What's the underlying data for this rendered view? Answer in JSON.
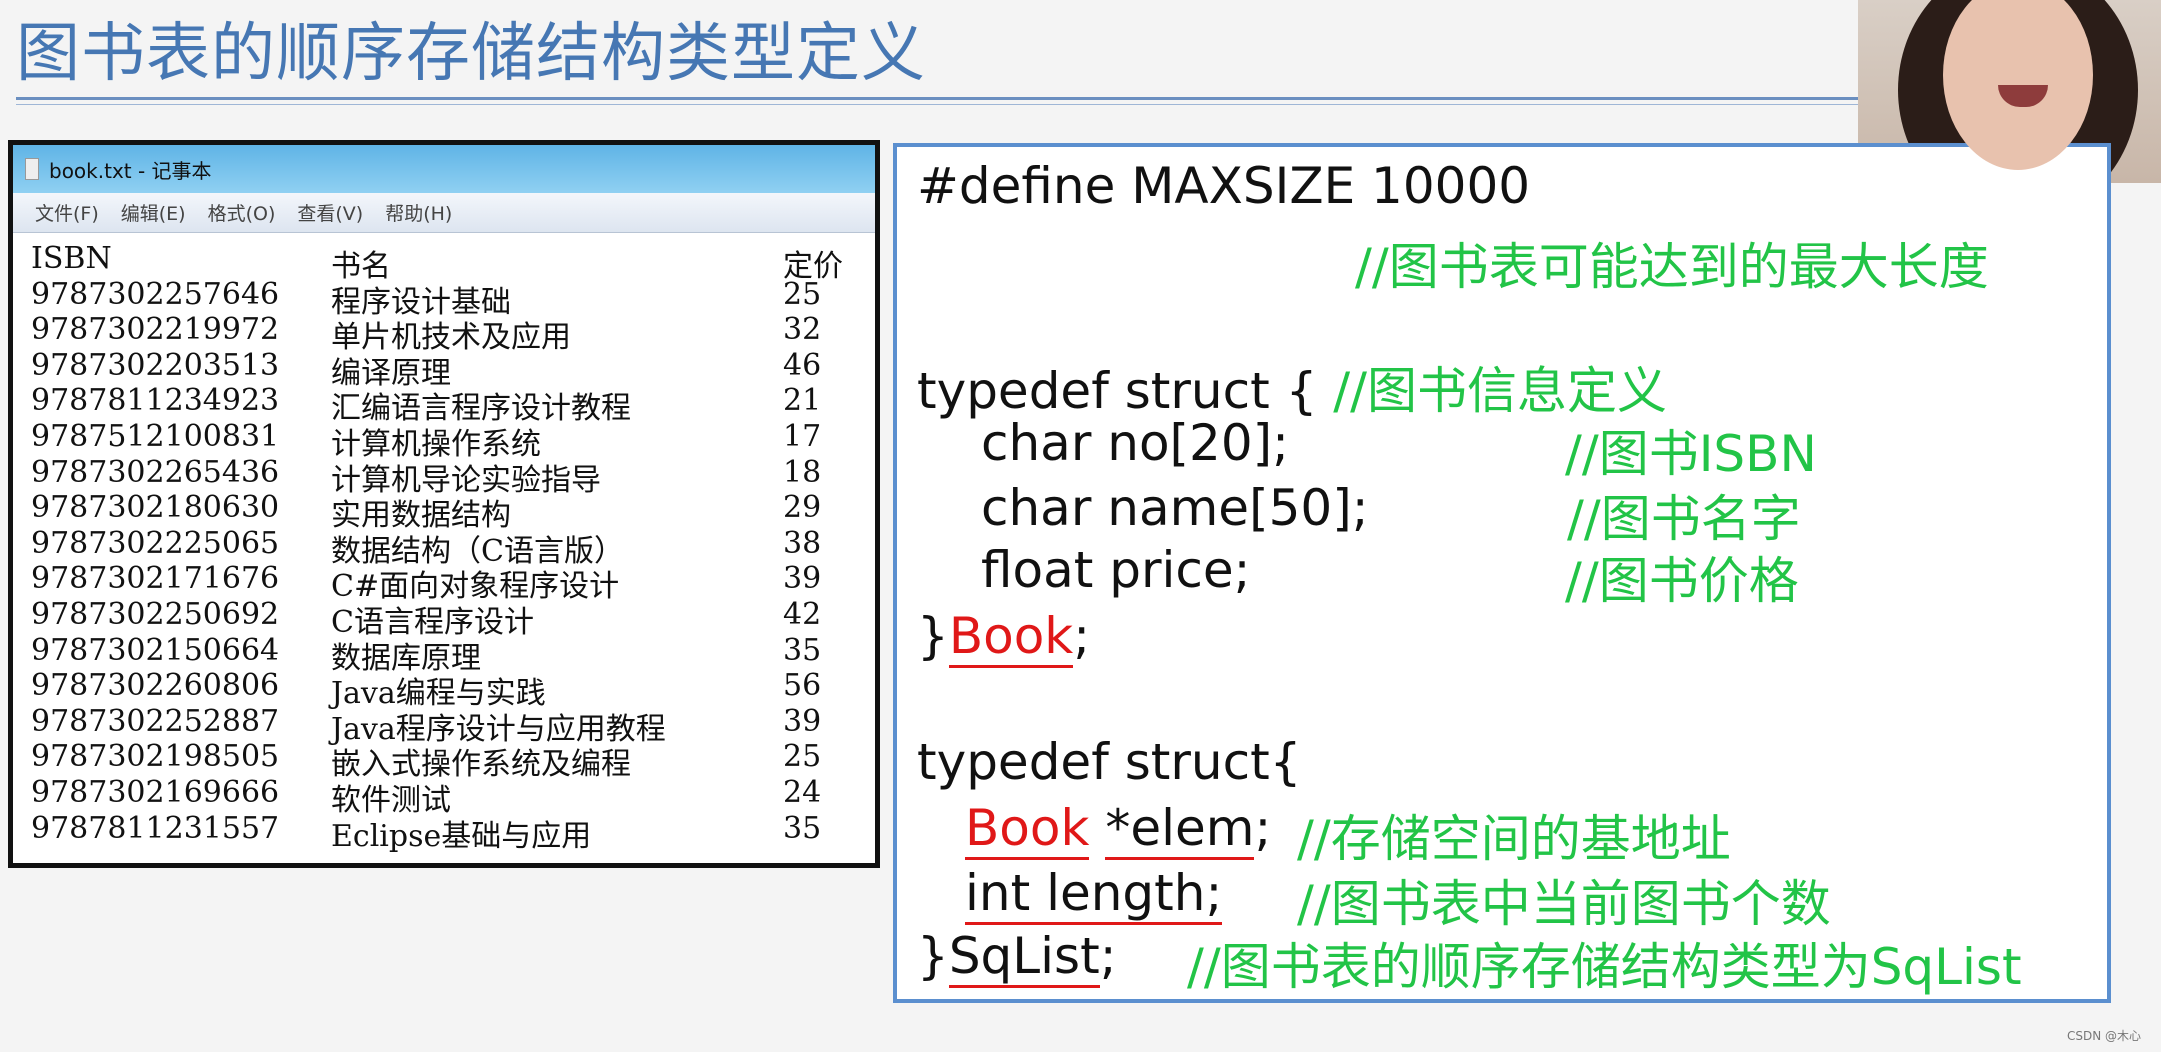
{
  "title": "图书表的顺序存储结构类型定义",
  "notepad": {
    "window_title": "book.txt - 记事本",
    "menu": [
      "文件(F)",
      "编辑(E)",
      "格式(O)",
      "查看(V)",
      "帮助(H)"
    ],
    "headers": [
      "ISBN",
      "书名",
      "定价"
    ],
    "rows": [
      [
        "9787302257646",
        "程序设计基础",
        "25"
      ],
      [
        "9787302219972",
        "单片机技术及应用",
        "32"
      ],
      [
        "9787302203513",
        "编译原理",
        "46"
      ],
      [
        "9787811234923",
        "汇编语言程序设计教程",
        "21"
      ],
      [
        "9787512100831",
        "计算机操作系统",
        "17"
      ],
      [
        "9787302265436",
        "计算机导论实验指导",
        "18"
      ],
      [
        "9787302180630",
        "实用数据结构",
        "29"
      ],
      [
        "9787302225065",
        "数据结构（C语言版）",
        "38"
      ],
      [
        "9787302171676",
        "C#面向对象程序设计",
        "39"
      ],
      [
        "9787302250692",
        "C语言程序设计",
        "42"
      ],
      [
        "9787302150664",
        "数据库原理",
        "35"
      ],
      [
        "9787302260806",
        "Java编程与实践",
        "56"
      ],
      [
        "9787302252887",
        "Java程序设计与应用教程",
        "39"
      ],
      [
        "9787302198505",
        "嵌入式操作系统及编程",
        "25"
      ],
      [
        "9787302169666",
        "软件测试",
        "24"
      ],
      [
        "9787811231557",
        "Eclipse基础与应用",
        "35"
      ]
    ]
  },
  "code": {
    "define": "#define MAXSIZE 10000",
    "define_comment": "//图书表可能达到的最大长度",
    "typedef1": "typedef struct   {",
    "typedef1_comment": "//图书信息定义",
    "no": "char no[20];",
    "no_comment": "//图书ISBN",
    "name": "char name[50];",
    "name_comment": "//图书名字",
    "price": "float price;",
    "price_comment": "//图书价格",
    "close1_brace": "}",
    "close1_name": "Book",
    "close1_semi": ";",
    "typedef2": "typedef struct{",
    "elem_type": "Book",
    "elem_name": "*elem",
    "elem_semi": ";",
    "elem_comment": "//存储空间的基地址",
    "length": "int length;",
    "length_comment": "//图书表中当前图书个数",
    "close2_brace": "}",
    "close2_name": "SqList",
    "close2_semi": ";",
    "close2_comment": "//图书表的顺序存储结构类型为SqList"
  },
  "watermark": "CSDN @木心",
  "colors": {
    "title": "#4677b3",
    "comment": "#22c447",
    "annotation": "#e01818",
    "border": "#5b8fcf"
  }
}
